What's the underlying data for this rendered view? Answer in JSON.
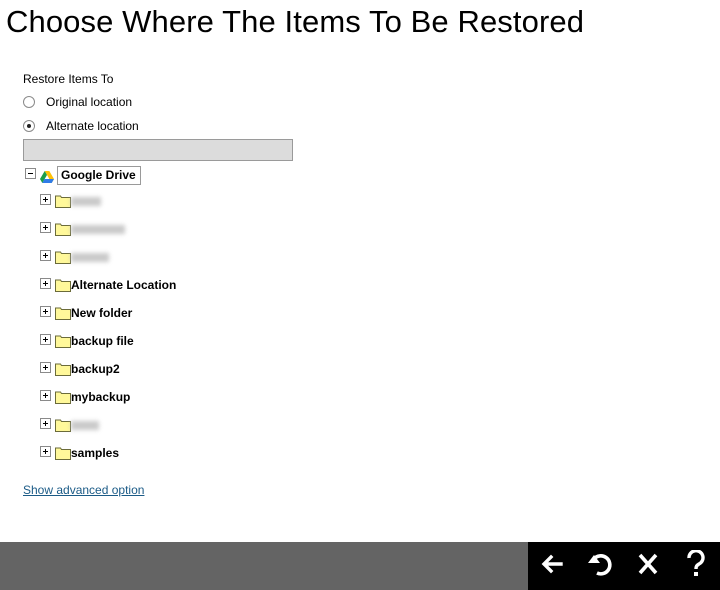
{
  "title": "Choose Where The Items To Be Restored",
  "restore_to": {
    "label": "Restore Items To",
    "options": [
      {
        "label": "Original location",
        "selected": false
      },
      {
        "label": "Alternate location",
        "selected": true
      }
    ]
  },
  "path_input": {
    "value": "",
    "placeholder": ""
  },
  "tree": {
    "root": {
      "label": "Google Drive",
      "icon": "google-drive-icon",
      "expanded": true
    },
    "folders": [
      {
        "label": "",
        "redacted": true
      },
      {
        "label": "",
        "redacted": true
      },
      {
        "label": "",
        "redacted": true
      },
      {
        "label": "Alternate Location"
      },
      {
        "label": "New folder"
      },
      {
        "label": "backup file"
      },
      {
        "label": "backup2"
      },
      {
        "label": "mybackup"
      },
      {
        "label": "",
        "redacted": true
      },
      {
        "label": "samples"
      }
    ]
  },
  "advanced_link": "Show advanced option",
  "footer": {
    "buttons": [
      {
        "name": "back",
        "icon": "arrow-left-icon"
      },
      {
        "name": "restore",
        "icon": "undo-icon"
      },
      {
        "name": "cancel",
        "icon": "close-icon"
      },
      {
        "name": "help",
        "icon": "question-icon"
      }
    ]
  },
  "colors": {
    "footer_bar": "#646464",
    "footer_actions": "#000000",
    "link": "#1a5a86",
    "input_bg": "#dcdcdc",
    "folder_fill": "#fff89a"
  }
}
